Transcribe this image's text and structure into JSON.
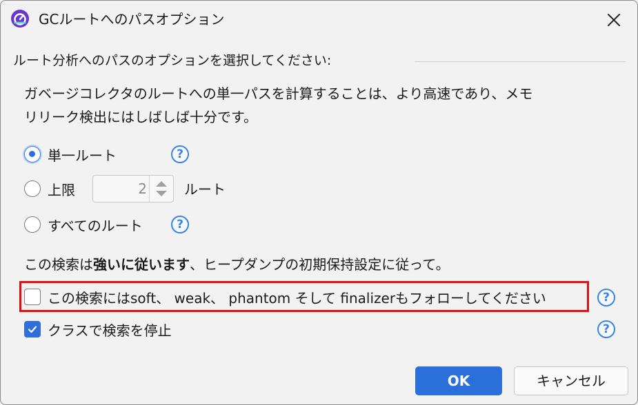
{
  "window": {
    "title": "GCルートへのパスオプション",
    "close_icon": "close-icon",
    "app_icon": "app-icon"
  },
  "section": {
    "heading": "ルート分析へのパスのオプションを選択してください:"
  },
  "description": {
    "line1": "ガベージコレクタのルートへの単一パスを計算することは、より高速であり、メモ",
    "line2": "リリーク検出にはしばしば十分です。"
  },
  "options": {
    "single_root": {
      "label": "単一ルート",
      "checked": true
    },
    "upper_limit": {
      "label": "上限",
      "value": "2",
      "suffix": "ルート",
      "checked": false
    },
    "all_roots": {
      "label": "すべてのルート",
      "checked": false
    }
  },
  "info": {
    "prefix": "この検索は",
    "bold": "強いに従います",
    "suffix": "、ヒープダンプの初期保持設定に従って。"
  },
  "checks": {
    "follow_weak": {
      "label": "この検索にはsoft、 weak、 phantom そして finalizerもフォローしてください",
      "checked": false
    },
    "stop_at_class": {
      "label": "クラスで検索を停止",
      "checked": true
    }
  },
  "help": {
    "glyph": "?"
  },
  "buttons": {
    "ok": "OK",
    "cancel": "キャンセル"
  },
  "colors": {
    "accent": "#2b6fdb",
    "highlight_border": "#e10f0f",
    "help": "#3b82e6"
  }
}
